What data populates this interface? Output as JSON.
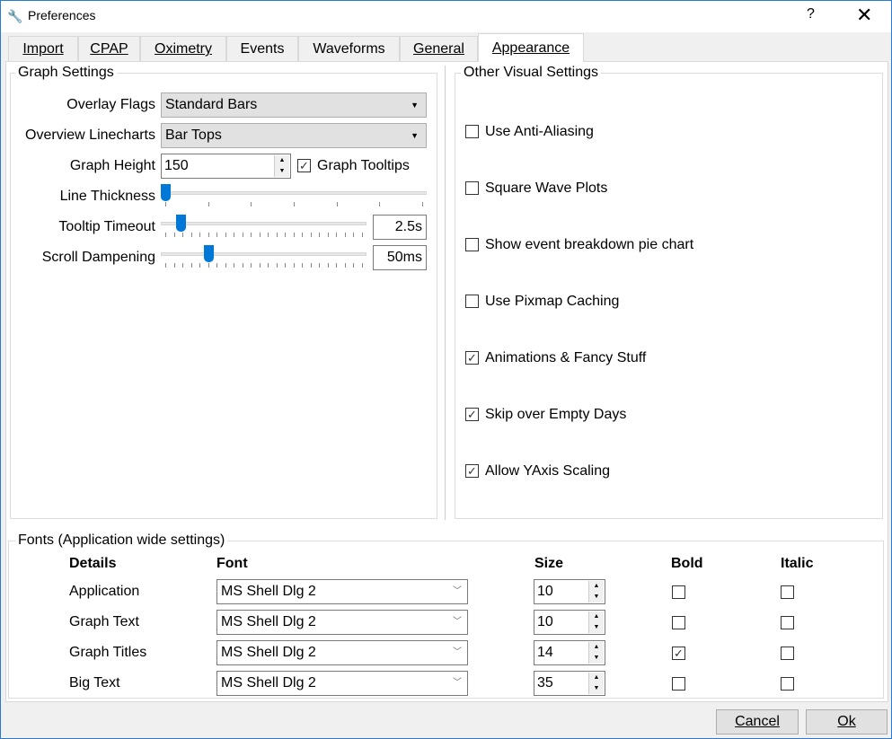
{
  "window": {
    "title": "Preferences",
    "help": "?",
    "close": "✕",
    "icon": "wrench-icon"
  },
  "tabs": [
    "Import",
    "CPAP",
    "Oximetry",
    "Events",
    "Waveforms",
    "General",
    "Appearance"
  ],
  "selected_tab": "Appearance",
  "graph_settings": {
    "title": "Graph Settings",
    "overlay_flags": {
      "label": "Overlay Flags",
      "value": "Standard Bars"
    },
    "overview_linecharts": {
      "label": "Overview Linecharts",
      "value": "Bar Tops"
    },
    "graph_height": {
      "label": "Graph Height",
      "value": "150"
    },
    "graph_tooltips": {
      "label": "Graph Tooltips",
      "checked": true
    },
    "line_thickness": {
      "label": "Line Thickness",
      "level": 0.0
    },
    "tooltip_timeout": {
      "label": "Tooltip Timeout",
      "value": "2.5s",
      "level": 0.08
    },
    "scroll_dampening": {
      "label": "Scroll Dampening",
      "value": "50ms",
      "level": 0.22
    }
  },
  "other_visual": {
    "title": "Other Visual Settings",
    "items": [
      {
        "label": "Use Anti-Aliasing",
        "checked": false
      },
      {
        "label": "Square Wave Plots",
        "checked": false
      },
      {
        "label": "Show event breakdown pie chart",
        "checked": false
      },
      {
        "label": "Use Pixmap Caching",
        "checked": false
      },
      {
        "label": "Animations & Fancy Stuff",
        "checked": true
      },
      {
        "label": "Skip over Empty Days",
        "checked": true
      },
      {
        "label": "Allow YAxis Scaling",
        "checked": true
      }
    ]
  },
  "fonts": {
    "title": "Fonts (Application wide settings)",
    "headers": [
      "Details",
      "Font",
      "Size",
      "Bold",
      "Italic"
    ],
    "rows": [
      {
        "detail": "Application",
        "font": "MS Shell Dlg 2",
        "size": "10",
        "bold": false,
        "italic": false
      },
      {
        "detail": "Graph Text",
        "font": "MS Shell Dlg 2",
        "size": "10",
        "bold": false,
        "italic": false
      },
      {
        "detail": "Graph Titles",
        "font": "MS Shell Dlg 2",
        "size": "14",
        "bold": true,
        "italic": false
      },
      {
        "detail": "Big  Text",
        "font": "MS Shell Dlg 2",
        "size": "35",
        "bold": false,
        "italic": false
      }
    ]
  },
  "buttons": {
    "cancel": "Cancel",
    "ok": "Ok"
  },
  "colors": {
    "accent": "#0078d7"
  }
}
